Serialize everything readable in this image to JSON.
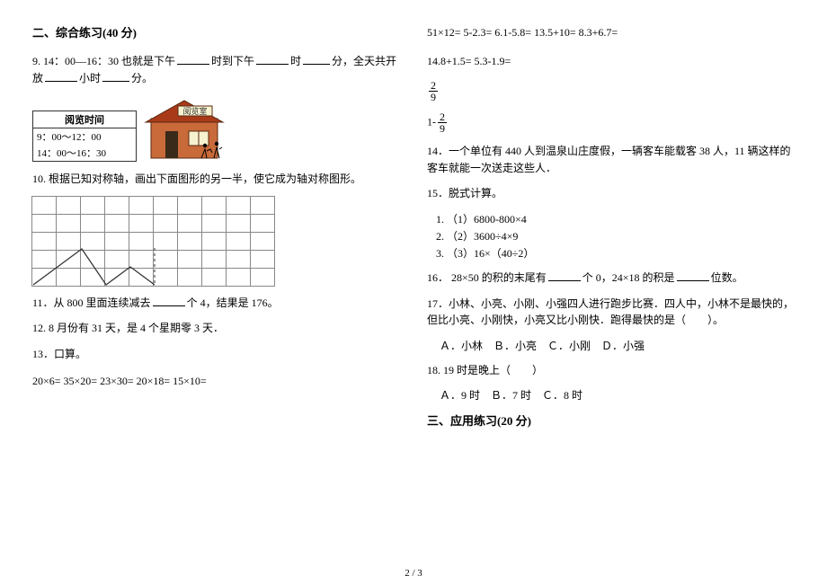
{
  "section2": {
    "title": "二、综合练习(40 分)",
    "q9a": "9. 14：00—16：30 也就是下午",
    "q9b": "时到下午",
    "q9c": "时",
    "q9d": "分，全天共开放",
    "q9e": "小时",
    "q9f": "分。",
    "sign_title": "阅览时间",
    "sign_line1": "9：00～12：00",
    "sign_line2": "14：00～16：30",
    "room_label": "阅览室",
    "q10": "10. 根据已知对称轴，画出下面图形的另一半，使它成为轴对称图形。",
    "q11a": "11．从 800 里面连续减去",
    "q11b": "个 4，结果是 176。",
    "q12": "12. 8 月份有 31 天，是 4 个星期零 3 天．",
    "q13": "13．口算。",
    "calc1": "20×6=            35×20=           23×30=           20×18=           15×10=",
    "calc2a": "51×12=            5-2.3=            6.1-5.8=          13.5+10=          8.3+6.7=",
    "calc2b": "14.8+1.5=       5.3-1.9=",
    "frac1_n": "2",
    "frac1_d": "9",
    "frac2_pre": "1-",
    "frac2_n": "2",
    "frac2_d": "9",
    "q14": "14．一个单位有 440 人到温泉山庄度假，一辆客车能载客 38 人，11 辆这样的客车就能一次送走这些人．",
    "q15": "15．脱式计算。",
    "q15_1": "（1）6800-800×4",
    "q15_2": "（2）3600÷4×9",
    "q15_3": "（3）16×（40÷2）",
    "q16a": "16．  28×50 的积的末尾有",
    "q16b": "个 0，24×18 的积是",
    "q16c": "位数。",
    "q17": "17．小林、小亮、小刚、小强四人进行跑步比赛．四人中，小林不是最快的，但比小亮、小刚快，小亮又比小刚快．跑得最快的是（　　）。",
    "q17_choices": "Ａ．小林　Ｂ．小亮　Ｃ．小刚　Ｄ．小强",
    "q18": "18. 19 时是晚上（　　）",
    "q18_choices": "Ａ．9 时　Ｂ．7 时　Ｃ．8 时"
  },
  "section3": {
    "title": "三、应用练习(20 分)"
  },
  "footer": "2 / 3"
}
